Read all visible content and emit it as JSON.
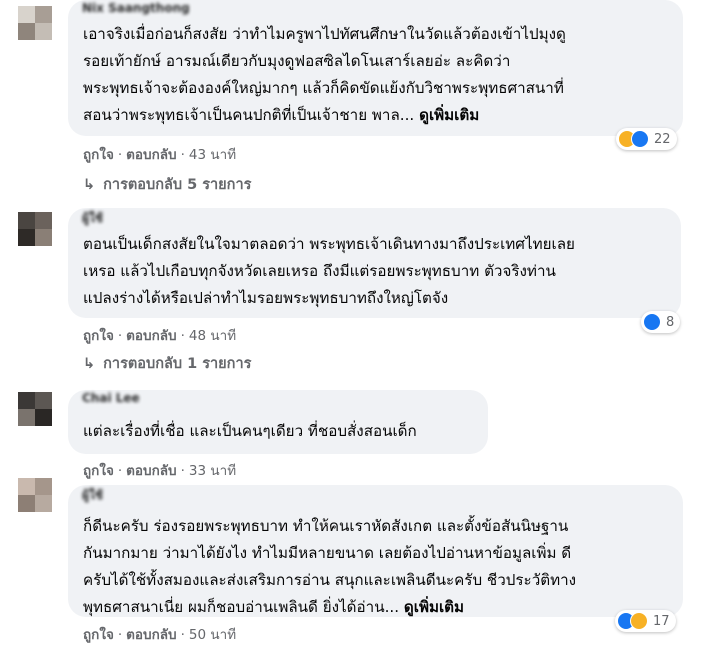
{
  "comments": [
    {
      "author": "Nix Saangthong",
      "lines": [
        "เอาจริงเมื่อก่อนก็สงสัย ว่าทำไมครูพาไปทัศนศึกษาในวัดแล้วต้องเข้าไปมุงดู",
        "รอยเท้ายักษ์ อารมณ์เดียวกับมุงดูฟอสซิลไดโนเสาร์เลยอ่ะ ละคิดว่า",
        "พระพุทธเจ้าจะต้ององค์ใหญ่มากๆ แล้วก็คิดขัดแย้งกับวิชาพระพุทธศาสนาที่",
        "สอนว่าพระพุทธเจ้าเป็นคนปกติที่เป็นเจ้าชาย พาล... "
      ],
      "see_more": "ดูเพิ่มเติม",
      "like": "ถูกใจ",
      "reply": "ตอบกลับ",
      "time": "43 นาที",
      "reaction_count": "22",
      "reaction_icons": [
        "haha-icon",
        "like-icon"
      ],
      "replies_label": "การตอบกลับ 5 รายการ"
    },
    {
      "author": "ผู้ใช้",
      "lines": [
        "ตอนเป็นเด็กสงสัยในใจมาตลอดว่า พระพุทธเจ้าเดินทางมาถึงประเทศไทยเลย",
        "เหรอ แล้วไปเกือบทุกจังหวัดเลยเหรอ ถึงมีแต่รอยพระพุทธบาท ตัวจริงท่าน",
        "แปลงร่างได้หรือเปล่าทำไมรอยพระพุทธบาทถึงใหญ่โตจัง"
      ],
      "like": "ถูกใจ",
      "reply": "ตอบกลับ",
      "time": "48 นาที",
      "reaction_count": "8",
      "reaction_icons": [
        "like-icon"
      ],
      "replies_label": "การตอบกลับ 1 รายการ"
    },
    {
      "author": "Chai Lee",
      "lines": [
        "แต่ละเรื่องที่เชื่อ และเป็นคนๆเดียว ที่ชอบสั่งสอนเด็ก"
      ],
      "like": "ถูกใจ",
      "reply": "ตอบกลับ",
      "time": "33 นาที"
    },
    {
      "author": "ผู้ใช้",
      "lines": [
        "ก็ดีนะครับ ร่องรอยพระพุทธบาท ทำให้คนเราหัดสังเกต และตั้งข้อสันนิษฐาน",
        "กันมากมาย ว่ามาได้ยังไง ทำไมมีหลายขนาด เลยต้องไปอ่านหาข้อมูลเพิ่ม ดี",
        "ครับได้ใช้ทั้งสมองและส่งเสริมการอ่าน สนุกและเพลินดีนะครับ ชีวประวัติทาง",
        "พุทธศาสนาเนี่ย ผมก็ชอบอ่านเพลินดี ยิ่งได้อ่าน... "
      ],
      "see_more": "ดูเพิ่มเติม",
      "like": "ถูกใจ",
      "reply": "ตอบกลับ",
      "time": "50 นาที",
      "reaction_count": "17",
      "reaction_icons": [
        "like-icon",
        "wow-icon"
      ]
    }
  ],
  "colors": {
    "bubble": "#f0f2f5",
    "meta_text": "#65676b",
    "like_blue": "#1877f2",
    "emoji_yellow": "#f7b125"
  }
}
